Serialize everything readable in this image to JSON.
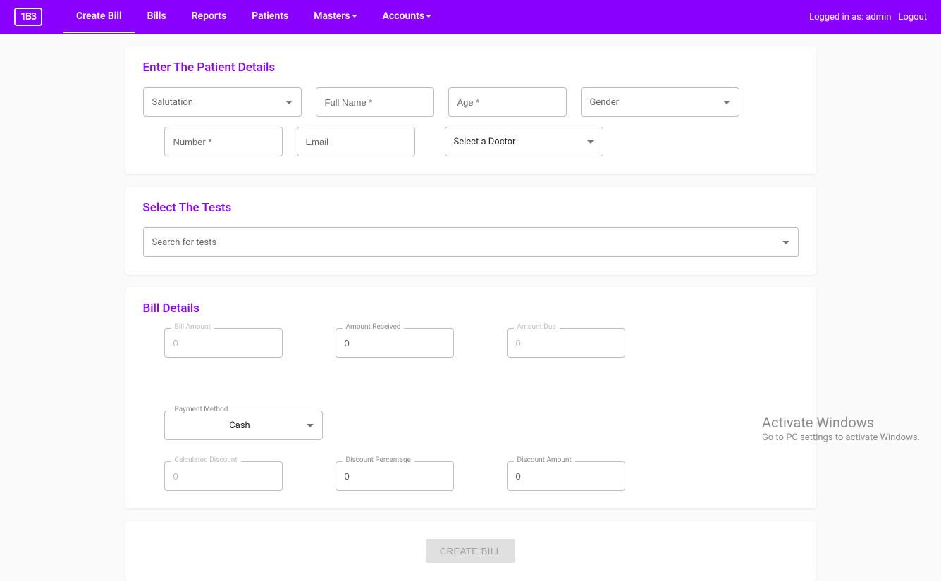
{
  "nav": {
    "logo": "1B3",
    "items": [
      {
        "label": "Create Bill",
        "active": true,
        "dropdown": false
      },
      {
        "label": "Bills",
        "active": false,
        "dropdown": false
      },
      {
        "label": "Reports",
        "active": false,
        "dropdown": false
      },
      {
        "label": "Patients",
        "active": false,
        "dropdown": false
      },
      {
        "label": "Masters",
        "active": false,
        "dropdown": true
      },
      {
        "label": "Accounts",
        "active": false,
        "dropdown": true
      }
    ],
    "logged_in_prefix": "Logged in as:",
    "logged_in_user": "admin",
    "logout": "Logout"
  },
  "patient": {
    "title": "Enter The Patient Details",
    "salutation": "Salutation",
    "fullname": "Full Name *",
    "age": "Age *",
    "gender": "Gender",
    "number": "Number *",
    "email": "Email",
    "doctor": "Select a Doctor"
  },
  "tests": {
    "title": "Select The Tests",
    "search": "Search for tests"
  },
  "bill": {
    "title": "Bill Details",
    "bill_amount_label": "Bill Amount",
    "bill_amount_value": "0",
    "amount_received_label": "Amount Received",
    "amount_received_value": "0",
    "amount_due_label": "Amount Due",
    "amount_due_value": "0",
    "payment_method_label": "Payment Method",
    "payment_method_value": "Cash",
    "calc_discount_label": "Calculated Discount",
    "calc_discount_value": "0",
    "disc_percent_label": "Discount Percentage",
    "disc_percent_value": "0",
    "disc_amount_label": "Discount Amount",
    "disc_amount_value": "0"
  },
  "submit": {
    "label": "CREATE BILL"
  },
  "watermark": {
    "line1": "Activate Windows",
    "line2": "Go to PC settings to activate Windows."
  }
}
